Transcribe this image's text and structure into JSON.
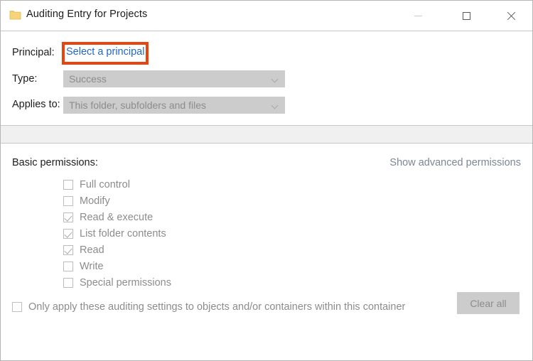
{
  "window": {
    "title": "Auditing Entry for Projects",
    "icon": "folder-icon",
    "controls": {
      "minimize": "minimize-icon",
      "maximize": "maximize-icon",
      "close": "close-icon"
    }
  },
  "colors": {
    "link": "#1f68c9",
    "highlight_box": "#e8450e",
    "disabled_control_bg": "#cccccc",
    "disabled_text": "#8c8c8c",
    "band_bg": "#f0f0f0",
    "window_border": "#b5b5b5"
  },
  "form": {
    "principal": {
      "label": "Principal:",
      "link_text": "Select a principal",
      "highlighted": true
    },
    "type": {
      "label": "Type:",
      "value": "Success",
      "chevron": "chevron-down-icon",
      "disabled": true
    },
    "applies_to": {
      "label": "Applies to:",
      "value": "This folder, subfolders and files",
      "chevron": "chevron-down-icon",
      "disabled": true
    }
  },
  "permissions": {
    "title": "Basic permissions:",
    "advanced_link": "Show advanced permissions",
    "items": [
      {
        "label": "Full control",
        "checked": false
      },
      {
        "label": "Modify",
        "checked": false
      },
      {
        "label": "Read & execute",
        "checked": true
      },
      {
        "label": "List folder contents",
        "checked": true
      },
      {
        "label": "Read",
        "checked": true
      },
      {
        "label": "Write",
        "checked": false
      },
      {
        "label": "Special permissions",
        "checked": false
      }
    ]
  },
  "footer": {
    "only_apply": {
      "label": "Only apply these auditing settings to objects and/or containers within this container",
      "checked": false
    },
    "clear_all_label": "Clear all"
  }
}
